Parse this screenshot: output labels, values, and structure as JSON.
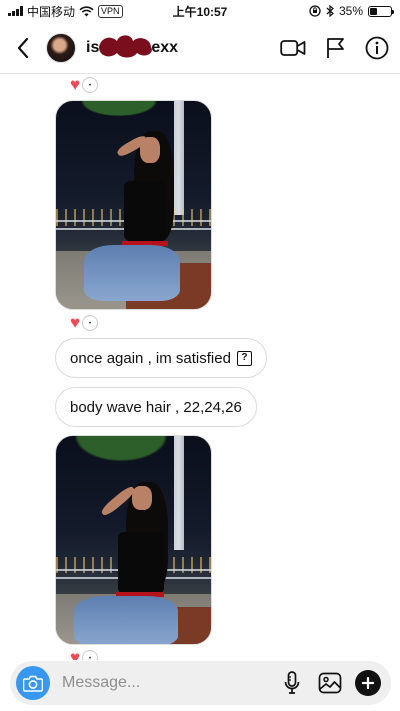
{
  "status_bar": {
    "carrier": "中国移动",
    "vpn": "VPN",
    "time": "上午10:57",
    "battery": "35%",
    "battery_level": 0.35
  },
  "header": {
    "username_start": "is",
    "username_end": "exx"
  },
  "thread": {
    "messages": [
      {
        "type": "text",
        "text": "once again , im satisfied",
        "glyph": "?"
      },
      {
        "type": "text",
        "text": "body wave hair , 22,24,26"
      }
    ]
  },
  "composer": {
    "placeholder": "Message..."
  },
  "colors": {
    "accent": "#3897f0",
    "heart": "#ed4956",
    "redact": "#7a0e1c"
  },
  "icons": [
    "back-icon",
    "video-call-icon",
    "flag-icon",
    "info-icon",
    "camera-icon",
    "microphone-icon",
    "gallery-icon",
    "plus-icon",
    "heart-icon"
  ]
}
